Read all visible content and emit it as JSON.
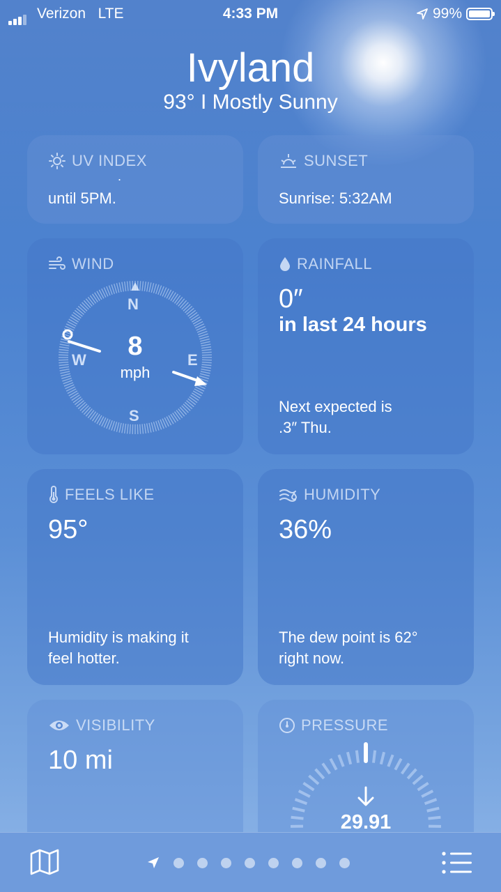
{
  "status_bar": {
    "carrier": "Verizon",
    "network": "LTE",
    "time": "4:33 PM",
    "battery": "99%"
  },
  "header": {
    "city": "Ivyland",
    "conditions": "93°  I  Mostly Sunny"
  },
  "uv_index": {
    "title": "UV INDEX",
    "dot": ".",
    "detail": "until 5PM."
  },
  "sunset": {
    "title": "SUNSET",
    "detail": "Sunrise: 5:32AM"
  },
  "wind": {
    "title": "WIND",
    "speed": "8",
    "unit": "mph",
    "north": "N",
    "south": "S",
    "east": "E",
    "west": "W"
  },
  "rainfall": {
    "title": "RAINFALL",
    "value": "0″",
    "period": "in last 24 hours",
    "note_line1": "Next expected is",
    "note_line2": ".3″ Thu."
  },
  "feels_like": {
    "title": "FEELS LIKE",
    "value": "95°",
    "note_line1": "Humidity is making it",
    "note_line2": "feel hotter."
  },
  "humidity": {
    "title": "HUMIDITY",
    "value": "36%",
    "note_line1": "The dew point is 62°",
    "note_line2": "right now."
  },
  "visibility": {
    "title": "VISIBILITY",
    "value": "10 mi"
  },
  "pressure": {
    "title": "PRESSURE",
    "value": "29.91"
  },
  "tab_bar": {
    "icons": [
      "map-icon",
      "location-arrow-icon",
      "list-icon"
    ],
    "page_dots": 8
  }
}
